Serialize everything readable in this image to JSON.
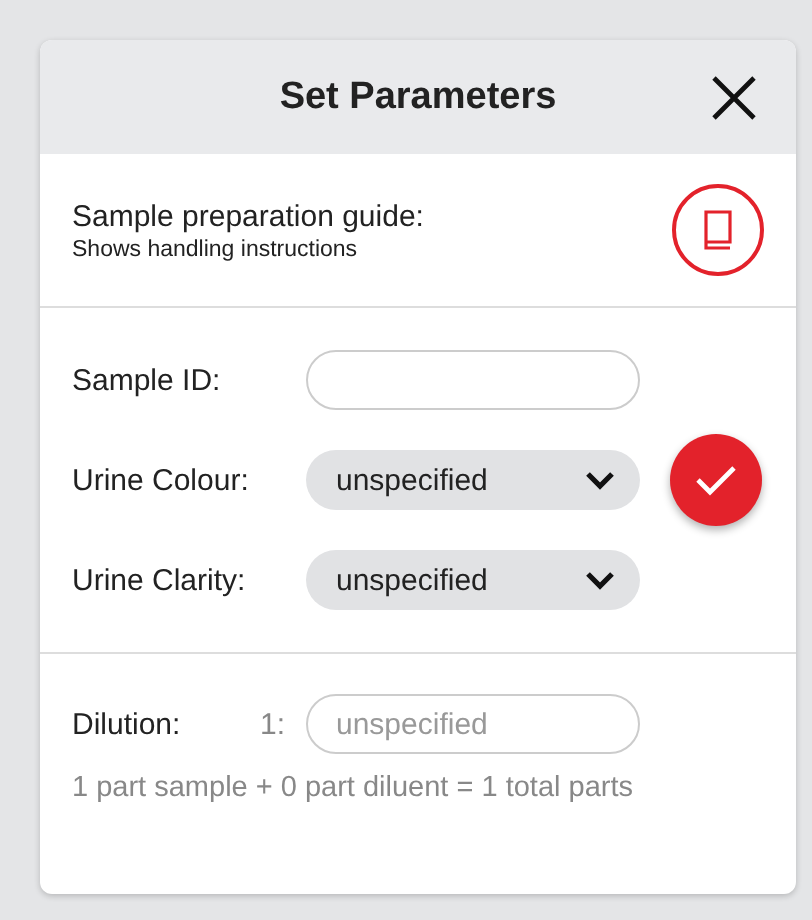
{
  "dialog": {
    "title": "Set Parameters"
  },
  "guide": {
    "title": "Sample preparation guide:",
    "subtitle": "Shows handling instructions"
  },
  "fields": [
    {
      "kind": "text",
      "label": "Sample ID:"
    },
    {
      "kind": "select",
      "label": "Urine Colour:",
      "value": "unspecified"
    },
    {
      "kind": "select",
      "label": "Urine Clarity:",
      "value": "unspecified"
    }
  ],
  "dilution": {
    "label": "Dilution:",
    "prefix": "1:",
    "placeholder": "unspecified",
    "summary": "1 part sample + 0 part diluent = 1 total parts"
  }
}
